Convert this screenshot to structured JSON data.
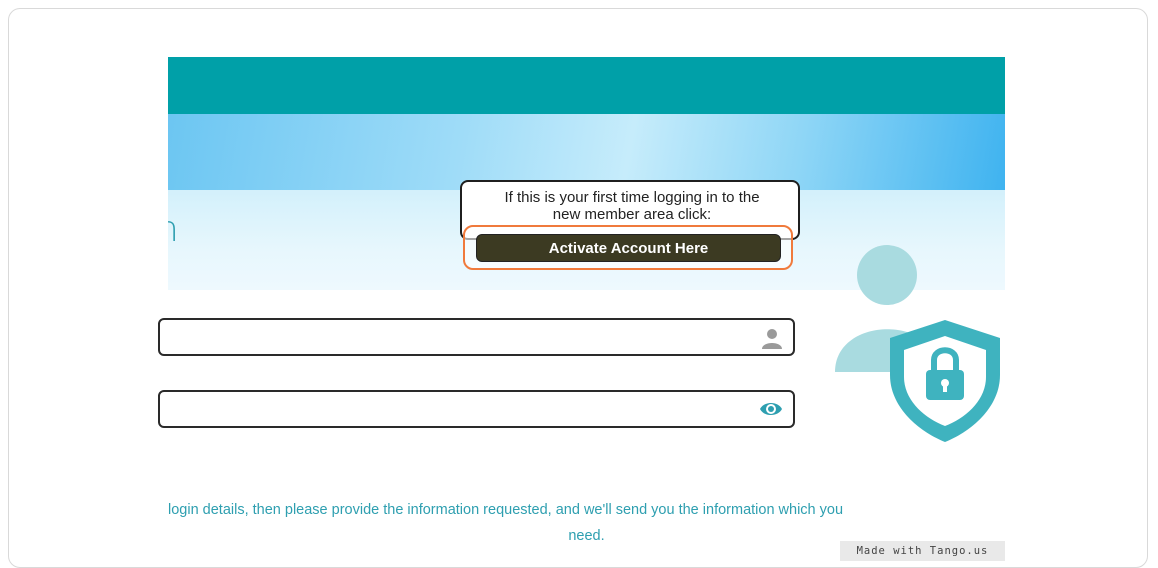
{
  "header": {
    "title_fragment": "n"
  },
  "form": {
    "username": {
      "value": "",
      "placeholder": "",
      "icon": "user-icon"
    },
    "password": {
      "value": "",
      "placeholder": "",
      "icon": "eye-icon"
    }
  },
  "tooltip": {
    "text_line1": "If this is your first time logging in to the",
    "text_line2": "new member area click:",
    "button_label": "Activate Account Here"
  },
  "help": {
    "line1": "login details, then please provide the information requested, and we'll send you the information which you",
    "line2": "need."
  },
  "illustration": {
    "icon": "user-security-shield-icon"
  },
  "watermark": {
    "label": "Made with Tango.us"
  },
  "colors": {
    "topbar": "#00a0a8",
    "accent_text": "#2e9fb0",
    "highlight": "#f07a3c",
    "button_bg": "#3c3a22"
  }
}
